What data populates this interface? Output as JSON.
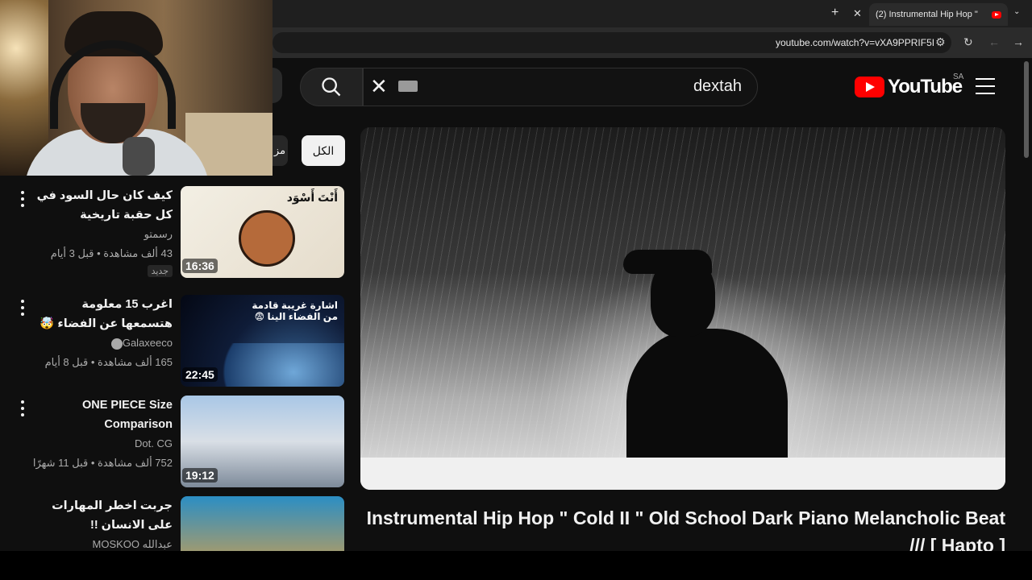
{
  "browser": {
    "tab_title": "(2) Instrumental Hip Hop \" ",
    "url": "youtube.com/watch?v=vXA9PPRIF5I",
    "new_tab_symbol": "+",
    "close_symbol": "✕"
  },
  "search": {
    "query": "dextah"
  },
  "header": {
    "logo_text": "YouTube",
    "country_code": "SA"
  },
  "chips": {
    "all_label": "الكل",
    "partial_label": "مز"
  },
  "player": {
    "title": "Instrumental Hip Hop \" Cold II \" Old School Dark Piano Melancholic Beat /// [ Hapto ]"
  },
  "sidebar": {
    "items": [
      {
        "title": "كيف كان حال السود في كل حقبة تاريخية",
        "channel": "رسمتو",
        "stats": "43 ألف مشاهدة • قبل 3 أيام",
        "badge": "جديد",
        "duration": "16:36",
        "thumb_text": "أَنْتَ أَسْوَد"
      },
      {
        "title": "اغرب 15 معلومة هتسمعها عن الفضاء 🤯",
        "channel": "Galaxeeco",
        "stats": "165 ألف مشاهدة • قبل 8 أيام",
        "duration": "22:45",
        "thumb_text": "اشارة غريبة قادمة من الفضاء الينا 😨"
      },
      {
        "title": "ONE PIECE Size Comparison",
        "channel": "Dot. CG",
        "stats": "752 ألف مشاهدة • قبل 11 شهرًا",
        "duration": "19:12"
      },
      {
        "title": "جربت اخطر المهارات على الانسان !!",
        "channel": "عبدالله MOSKOO"
      }
    ]
  }
}
